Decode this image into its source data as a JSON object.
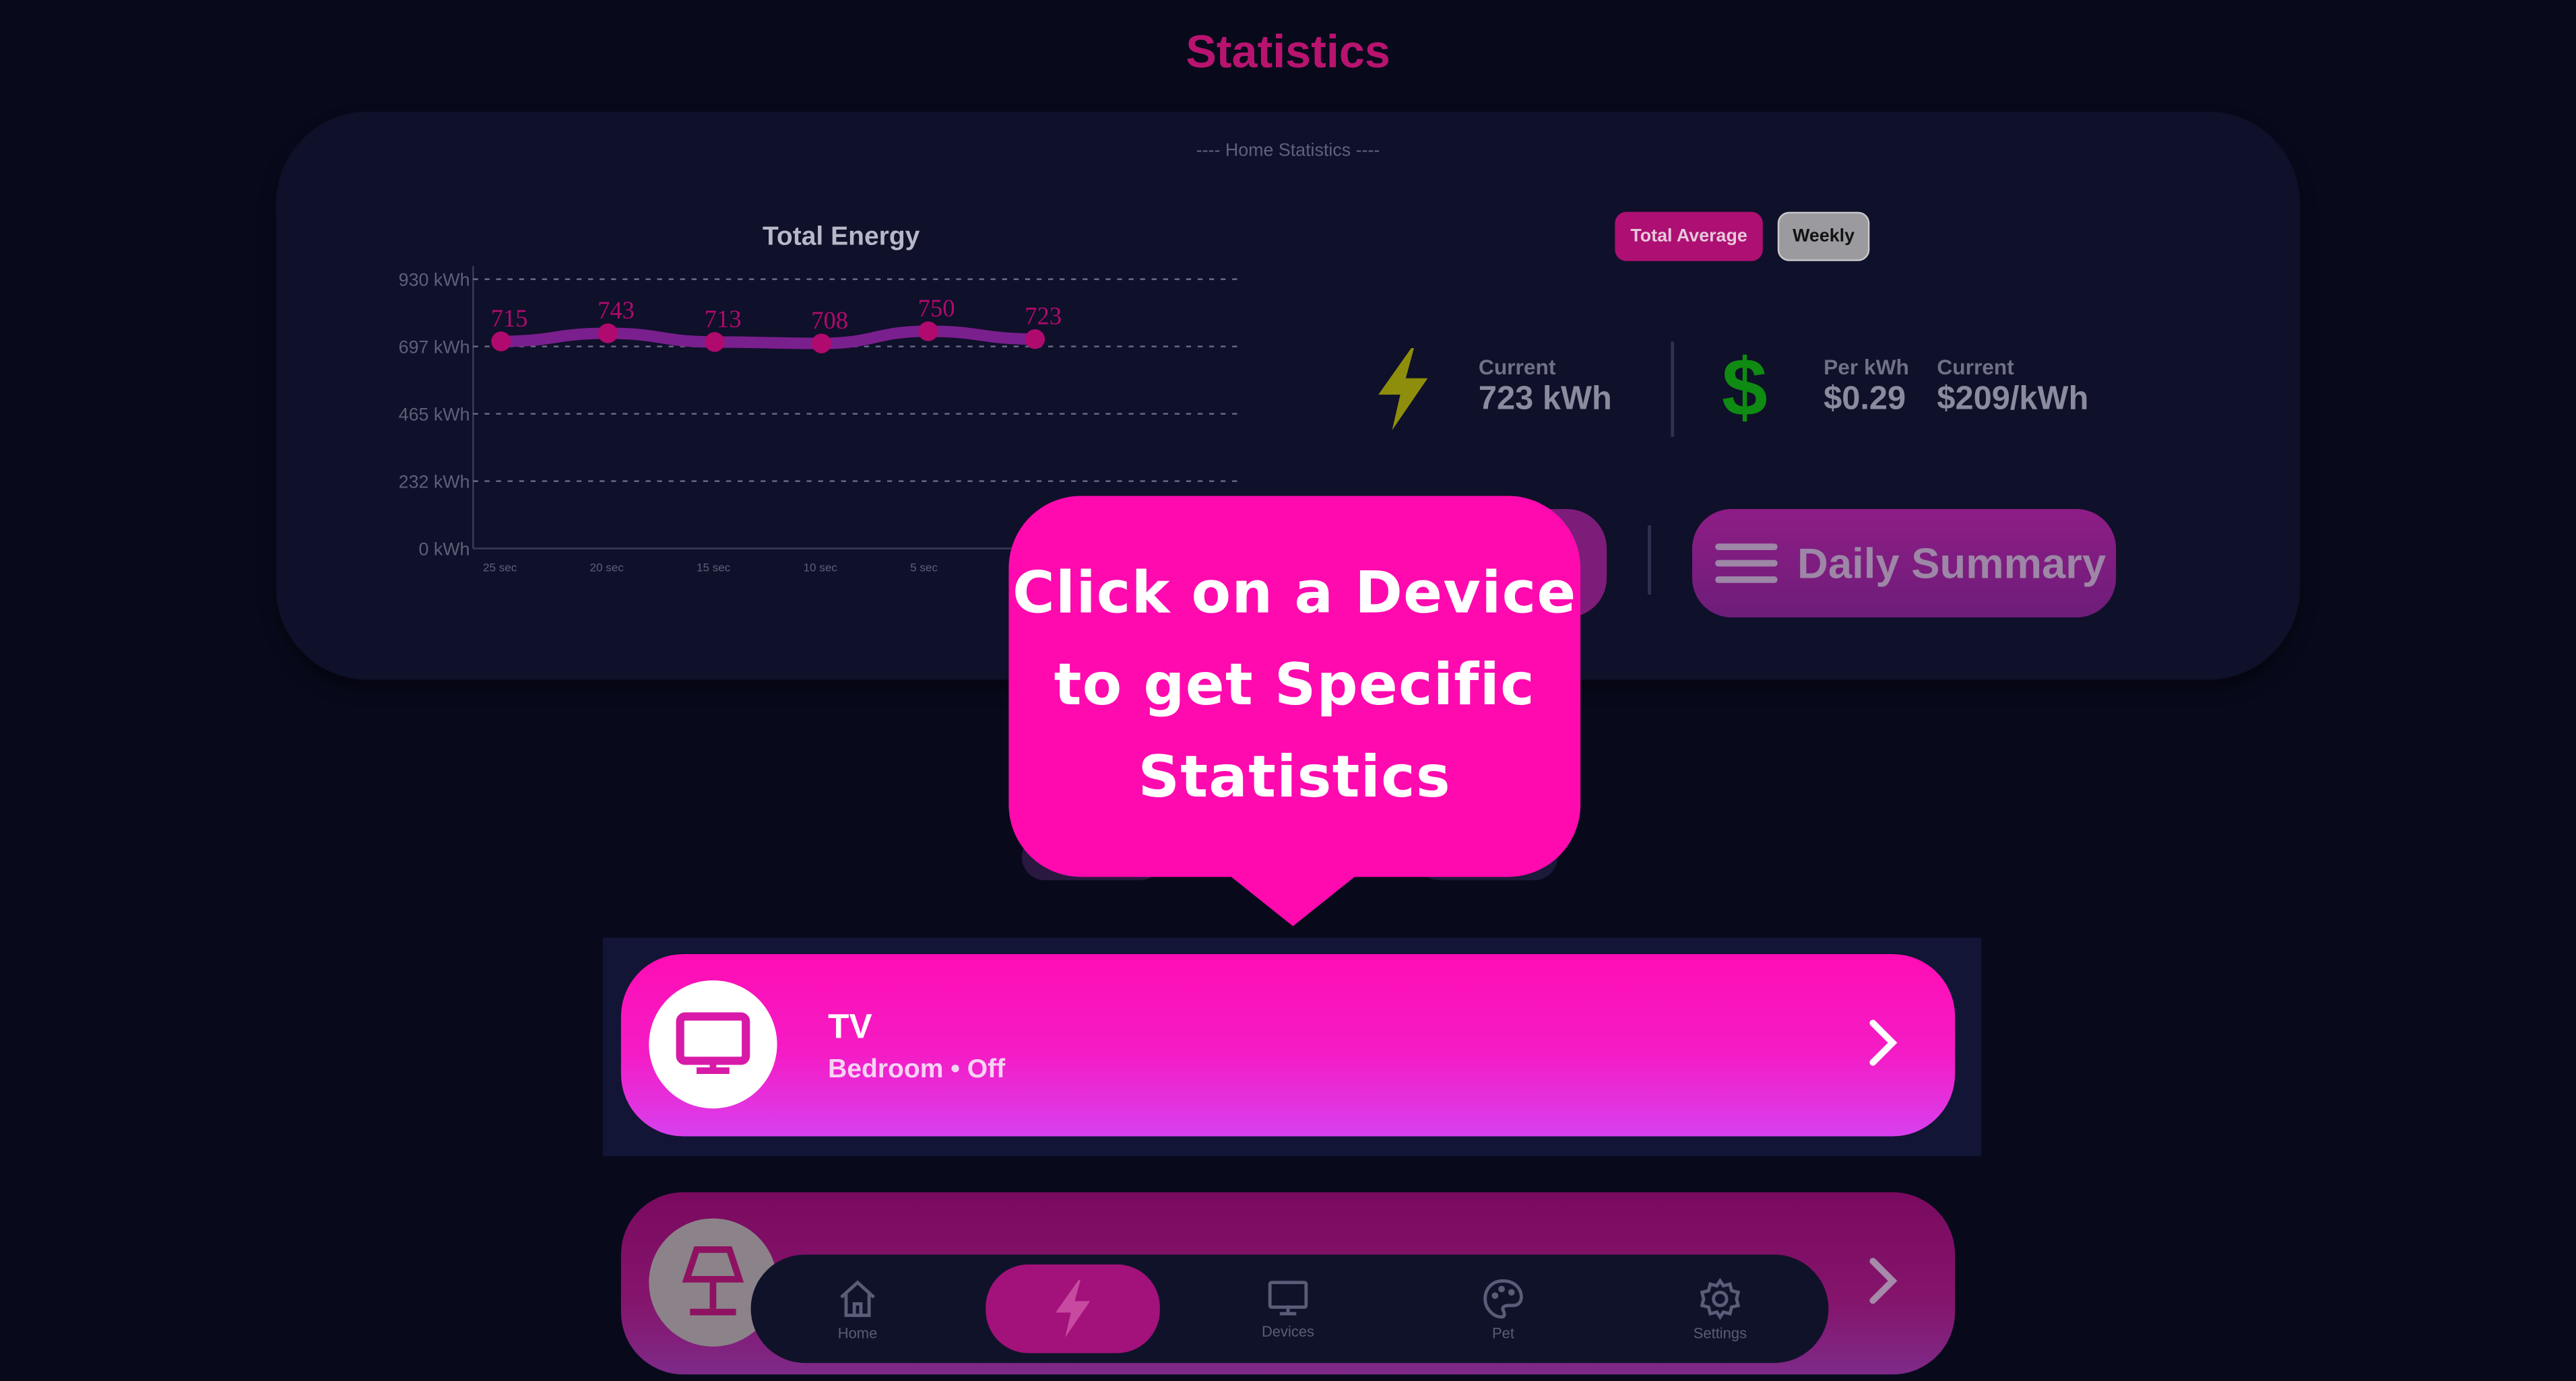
{
  "header": {
    "title": "Statistics"
  },
  "stats_card": {
    "caption": "---- Home Statistics ----",
    "toggle": {
      "active_label": "Total Average",
      "inactive_label": "Weekly"
    },
    "energy": {
      "icon": "lightning-bolt-icon",
      "label": "Current",
      "value": "723 kWh",
      "color": "#8e8e0c"
    },
    "cost": {
      "icon": "dollar-icon",
      "color": "#0f8a12",
      "per_kwh_label": "Per kWh",
      "per_kwh_value": "$0.29",
      "current_label": "Current",
      "current_value": "$209/kWh"
    },
    "summary_button": {
      "icon": "menu-lines-icon",
      "label": "Daily Summary"
    }
  },
  "chart_data": {
    "type": "line",
    "title": "Total Energy",
    "x": [
      "25 sec",
      "20 sec",
      "15 sec",
      "10 sec",
      "5 sec",
      ""
    ],
    "series": [
      {
        "values": [
          715,
          743,
          713,
          708,
          750,
          723
        ],
        "color": "#7a1f8e",
        "point_color": "#b00a6e"
      }
    ],
    "y_ticks": [
      "930 kWh",
      "697 kWh",
      "465 kWh",
      "232 kWh",
      "0 kWh"
    ],
    "ylim": [
      0,
      930
    ],
    "grid": true
  },
  "tooltip": {
    "text": "Click on a Device to get Specific Statistics"
  },
  "devices": [
    {
      "name": "TV",
      "subtitle": "Bedroom • Off",
      "icon": "tv-monitor-icon"
    },
    {
      "name": "",
      "subtitle": "",
      "icon": "lamp-icon"
    }
  ],
  "nav": [
    {
      "label": "Home",
      "icon": "home-icon"
    },
    {
      "label": "",
      "icon": "lightning-bolt-icon",
      "active": true
    },
    {
      "label": "Devices",
      "icon": "monitor-icon"
    },
    {
      "label": "Pet",
      "icon": "palette-icon"
    },
    {
      "label": "Settings",
      "icon": "gear-icon"
    }
  ]
}
